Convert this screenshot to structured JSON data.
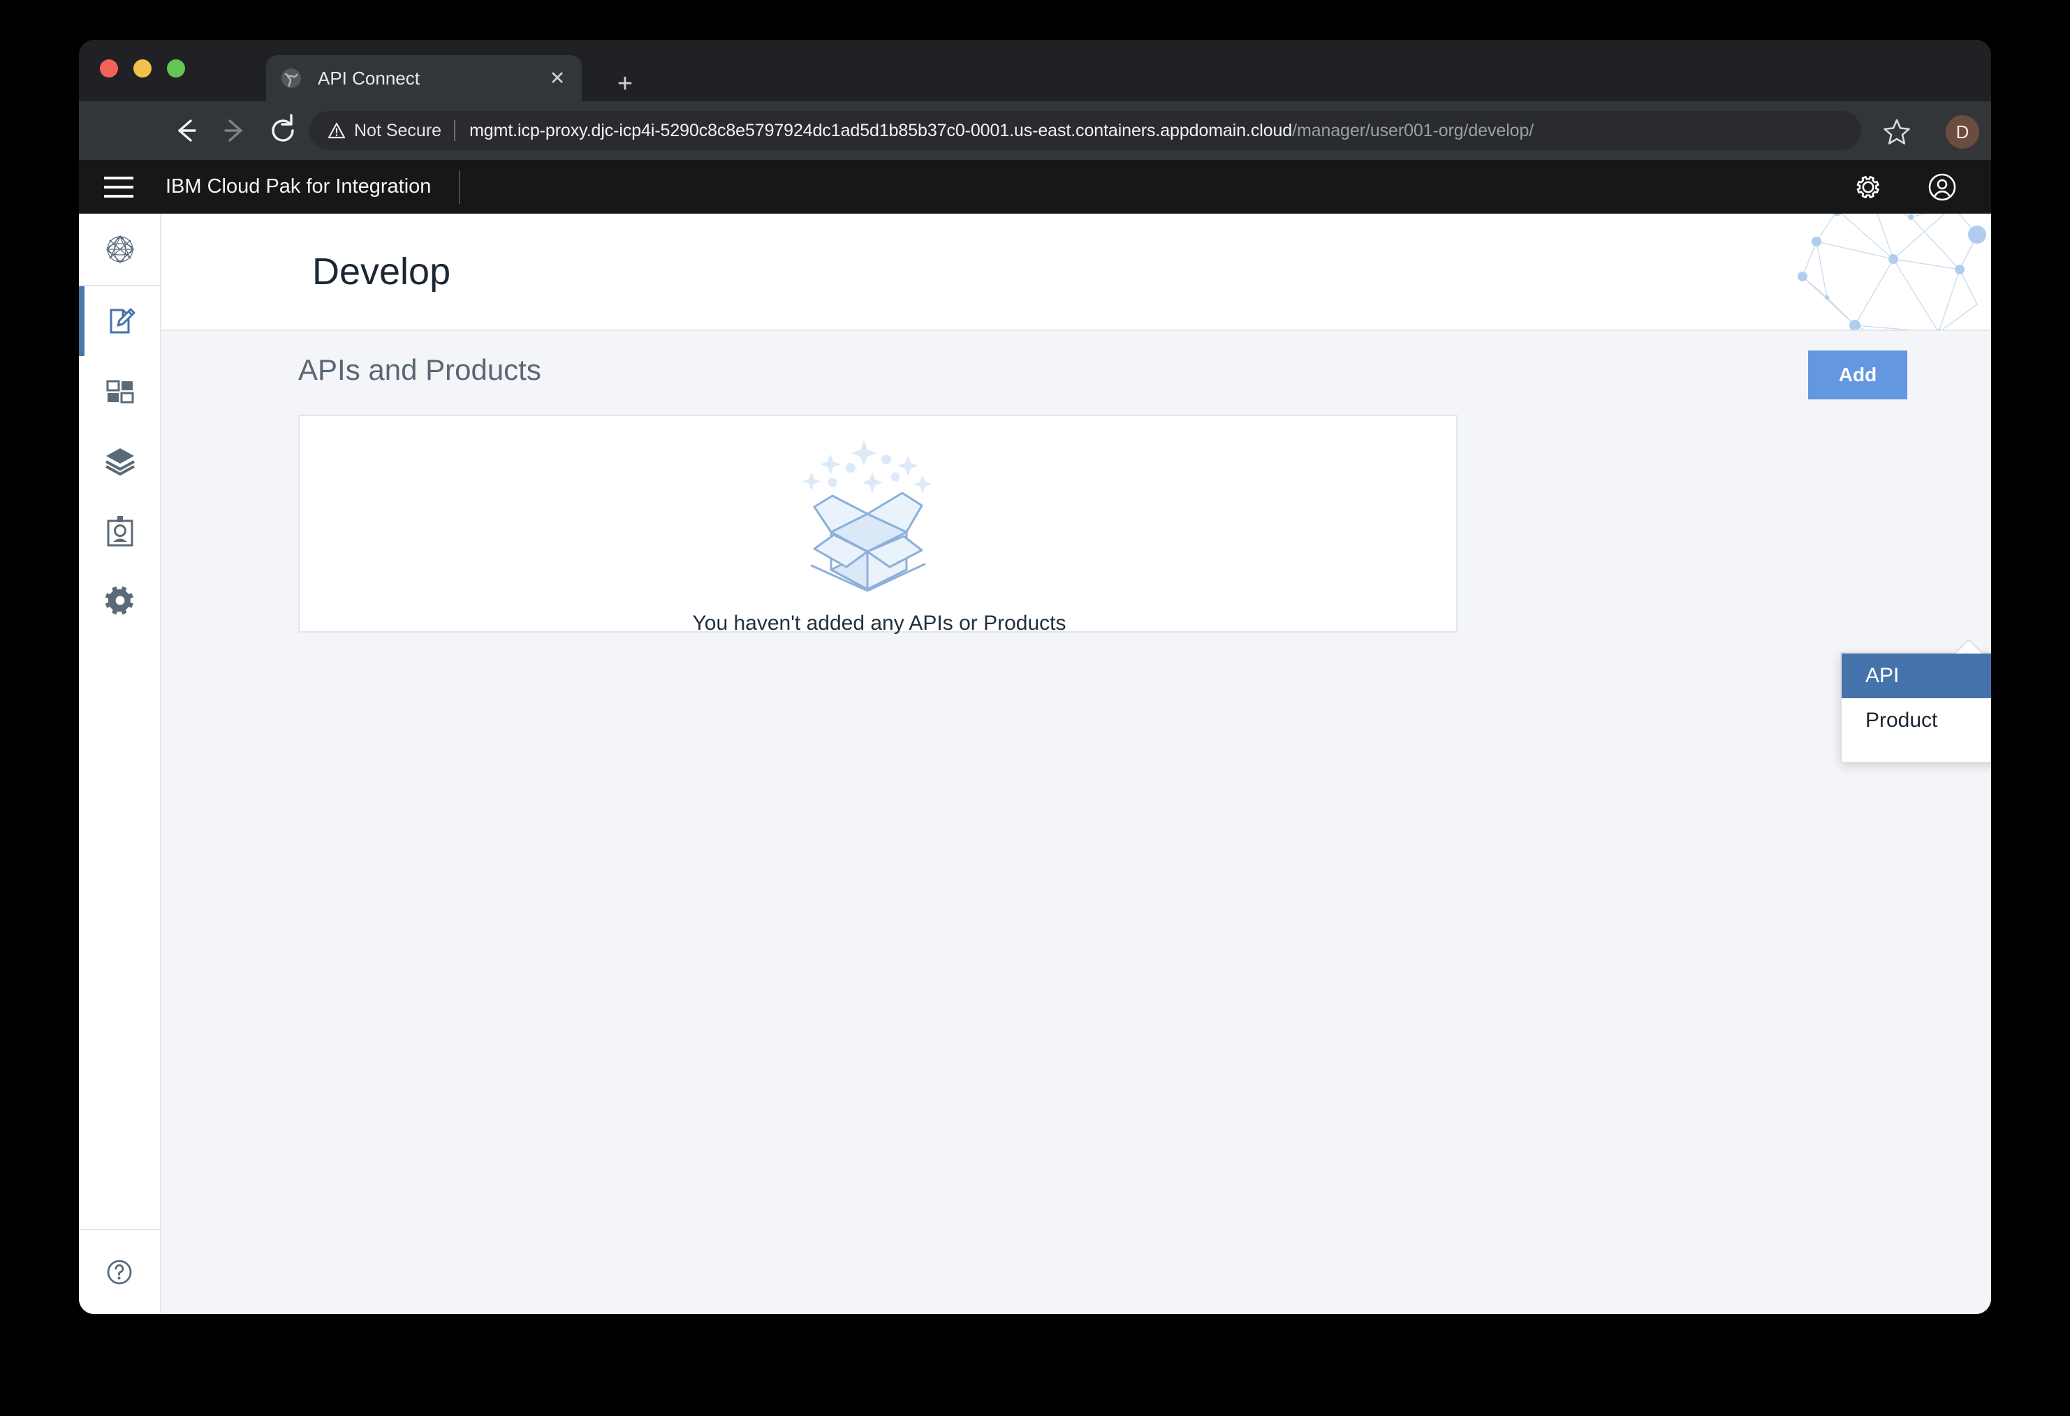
{
  "browser": {
    "tab": {
      "title": "API Connect",
      "favicon": "globe-icon",
      "close_label": "✕"
    },
    "new_tab_label": "+",
    "nav": {
      "back": "back-arrow-icon",
      "forward": "forward-arrow-icon",
      "reload": "reload-icon"
    },
    "omnibox": {
      "security_label": "Not Secure",
      "security_icon": "warning-triangle-icon",
      "url_host": "mgmt.icp-proxy.djc-icp4i-5290c8c8e5797924dc1ad5d1b85b37c0-0001.us-east.containers.appdomain.cloud",
      "url_path": "/manager/user001-org/develop/",
      "bookmark_icon": "star-icon"
    },
    "profile_initial": "D",
    "menu_icon": "three-dot-menu-icon"
  },
  "app_header": {
    "menu_icon": "hamburger-icon",
    "title": "IBM Cloud Pak for Integration",
    "actions": [
      {
        "name": "settings",
        "icon": "gear-icon"
      },
      {
        "name": "account",
        "icon": "user-avatar-icon"
      }
    ]
  },
  "left_rail": {
    "items": [
      {
        "name": "home",
        "icon": "network-sphere-icon",
        "active": false
      },
      {
        "name": "develop",
        "icon": "document-pencil-icon",
        "active": true
      },
      {
        "name": "dashboard",
        "icon": "tiles-icon",
        "active": false
      },
      {
        "name": "stack",
        "icon": "layers-icon",
        "active": false
      },
      {
        "name": "identity",
        "icon": "id-badge-icon",
        "active": false
      },
      {
        "name": "settings",
        "icon": "gear-icon",
        "active": false
      }
    ],
    "help": {
      "name": "help",
      "icon": "question-circle-icon"
    }
  },
  "page": {
    "title": "Develop",
    "banner_art": "network-graph-decoration",
    "section_title": "APIs and Products",
    "add_button": {
      "label": "Add",
      "color": "#6397e0"
    },
    "add_dropdown": {
      "open": true,
      "items": [
        {
          "label": "API",
          "selected": true
        },
        {
          "label": "Product",
          "selected": false
        }
      ],
      "selected_color": "#4672ab"
    },
    "empty_state": {
      "illustration": "open-box-with-sparkles-icon",
      "message": "You haven't added any APIs or Products",
      "stroke_color": "#8cb0da",
      "fill_color": "#eaf2fb"
    }
  }
}
